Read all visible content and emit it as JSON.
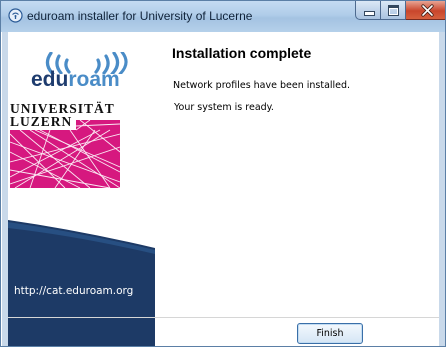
{
  "window": {
    "title": "eduroam installer for University of Lucerne"
  },
  "sidebar": {
    "logo_edu": "edu",
    "logo_roam": "roam",
    "university_line1": "UNIVERSITÄT",
    "university_line2": "LUZERN",
    "url": "http://cat.eduroam.org"
  },
  "content": {
    "title": "Installation complete",
    "line1": "Network profiles have been installed.",
    "line2": "Your system is ready."
  },
  "footer": {
    "finish_label": "Finish"
  },
  "colors": {
    "sidebar_blue": "#1d3a66",
    "eduroam_dark": "#1e3c6e",
    "eduroam_light": "#4a8cc7",
    "uni_magenta": "#d6187f",
    "close_red": "#c9462c"
  }
}
